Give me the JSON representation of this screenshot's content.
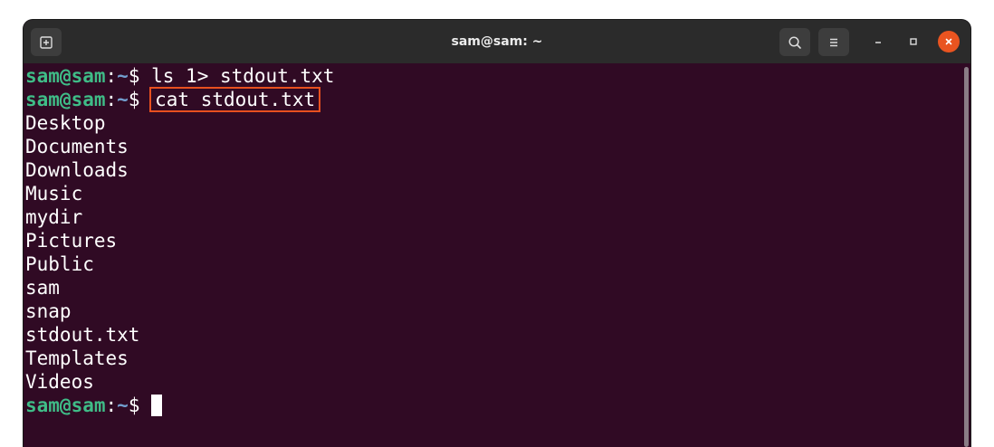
{
  "window": {
    "title": "sam@sam: ~"
  },
  "prompt": {
    "user_host": "sam@sam",
    "colon": ":",
    "path": "~",
    "dollar": "$ "
  },
  "terminal": {
    "commands": [
      {
        "text": "ls 1> stdout.txt",
        "highlighted": false
      },
      {
        "text": "cat stdout.txt",
        "highlighted": true
      }
    ],
    "output": [
      "Desktop",
      "Documents",
      "Downloads",
      "Music",
      "mydir",
      "Pictures",
      "Public",
      "sam",
      "snap",
      "stdout.txt",
      "Templates",
      "Videos"
    ]
  },
  "colors": {
    "background": "#300a24",
    "prompt_user": "#3fbc87",
    "prompt_path": "#729fcf",
    "highlight_box": "#e8501f",
    "close_button": "#e95420"
  },
  "icons": {
    "new_tab": "new-tab-icon",
    "search": "search-icon",
    "menu": "hamburger-menu-icon",
    "minimize": "minimize-icon",
    "maximize": "maximize-icon",
    "close": "close-icon"
  }
}
